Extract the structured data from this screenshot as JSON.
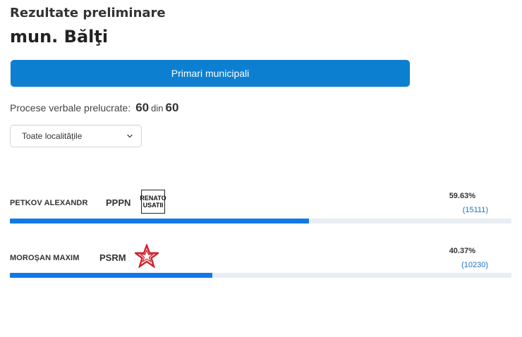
{
  "header": {
    "subtitle": "Rezultate preliminare",
    "title": "mun. Bălţi"
  },
  "tab_button": {
    "label": "Primari municipali"
  },
  "protocols": {
    "label": "Procese verbale prelucrate:",
    "processed": "60",
    "separator": "din",
    "total": "60"
  },
  "locality_select": {
    "selected": "Toate localitățile"
  },
  "colors": {
    "accent": "#0d7fd0",
    "bar": "#0f7ae5",
    "bar_track": "#e9eef5",
    "votes_link": "#1a73c9",
    "psrm_star": "#d2202b"
  },
  "candidates": [
    {
      "name": "PETKOV ALEXANDR",
      "party": "PPPN",
      "logo": {
        "type": "renato-usatii-logo",
        "line1": "RENATO",
        "line2": "USATII"
      },
      "percent": "59.63%",
      "votes": "(15111)",
      "share": 0.5963
    },
    {
      "name": "MOROȘAN MAXIM",
      "party": "PSRM",
      "logo": {
        "type": "psrm-star-logo"
      },
      "percent": "40.37%",
      "votes": "(10230)",
      "share": 0.4037
    }
  ]
}
